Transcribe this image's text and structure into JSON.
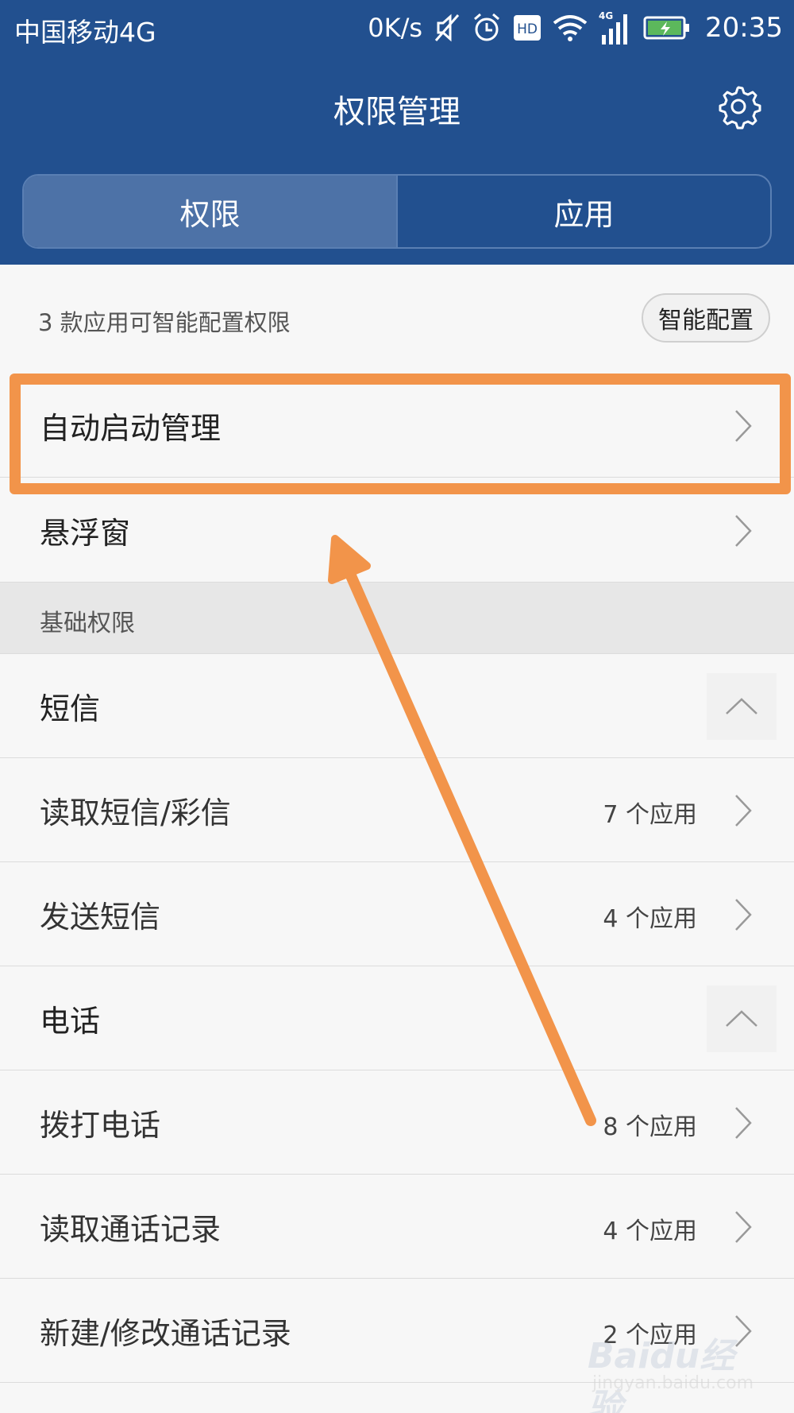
{
  "status_bar": {
    "carrier": "中国移动4G",
    "net_speed": "0K/s",
    "hd_badge": "HD",
    "signal_badge": "4G",
    "time": "20:35",
    "icons": [
      "mute-icon",
      "alarm-icon",
      "hd-icon",
      "wifi-icon",
      "signal-icon",
      "battery-charging-icon"
    ]
  },
  "header": {
    "title": "权限管理",
    "settings_icon": "gear-icon",
    "tabs": [
      {
        "label": "权限",
        "active": true
      },
      {
        "label": "应用",
        "active": false
      }
    ]
  },
  "smart_config": {
    "text": "3 款应用可智能配置权限",
    "button_label": "智能配置"
  },
  "items_top": [
    {
      "label": "自动启动管理"
    },
    {
      "label": "悬浮窗"
    }
  ],
  "section": {
    "label": "基础权限"
  },
  "groups": [
    {
      "label": "短信",
      "items": [
        {
          "label": "读取短信/彩信",
          "count": "7 个应用"
        },
        {
          "label": "发送短信",
          "count": "4 个应用"
        }
      ]
    },
    {
      "label": "电话",
      "items": [
        {
          "label": "拨打电话",
          "count": "8 个应用"
        },
        {
          "label": "读取通话记录",
          "count": "4 个应用"
        },
        {
          "label": "新建/修改通话记录",
          "count": "2 个应用"
        }
      ]
    }
  ],
  "watermark": {
    "brand": "Baidu经验",
    "url": "jingyan.baidu.com"
  },
  "colors": {
    "header_bg": "#22508f",
    "tab_active_bg": "#4d72a7",
    "annotation_orange": "#f2944a",
    "battery_green": "#5cb85c"
  }
}
